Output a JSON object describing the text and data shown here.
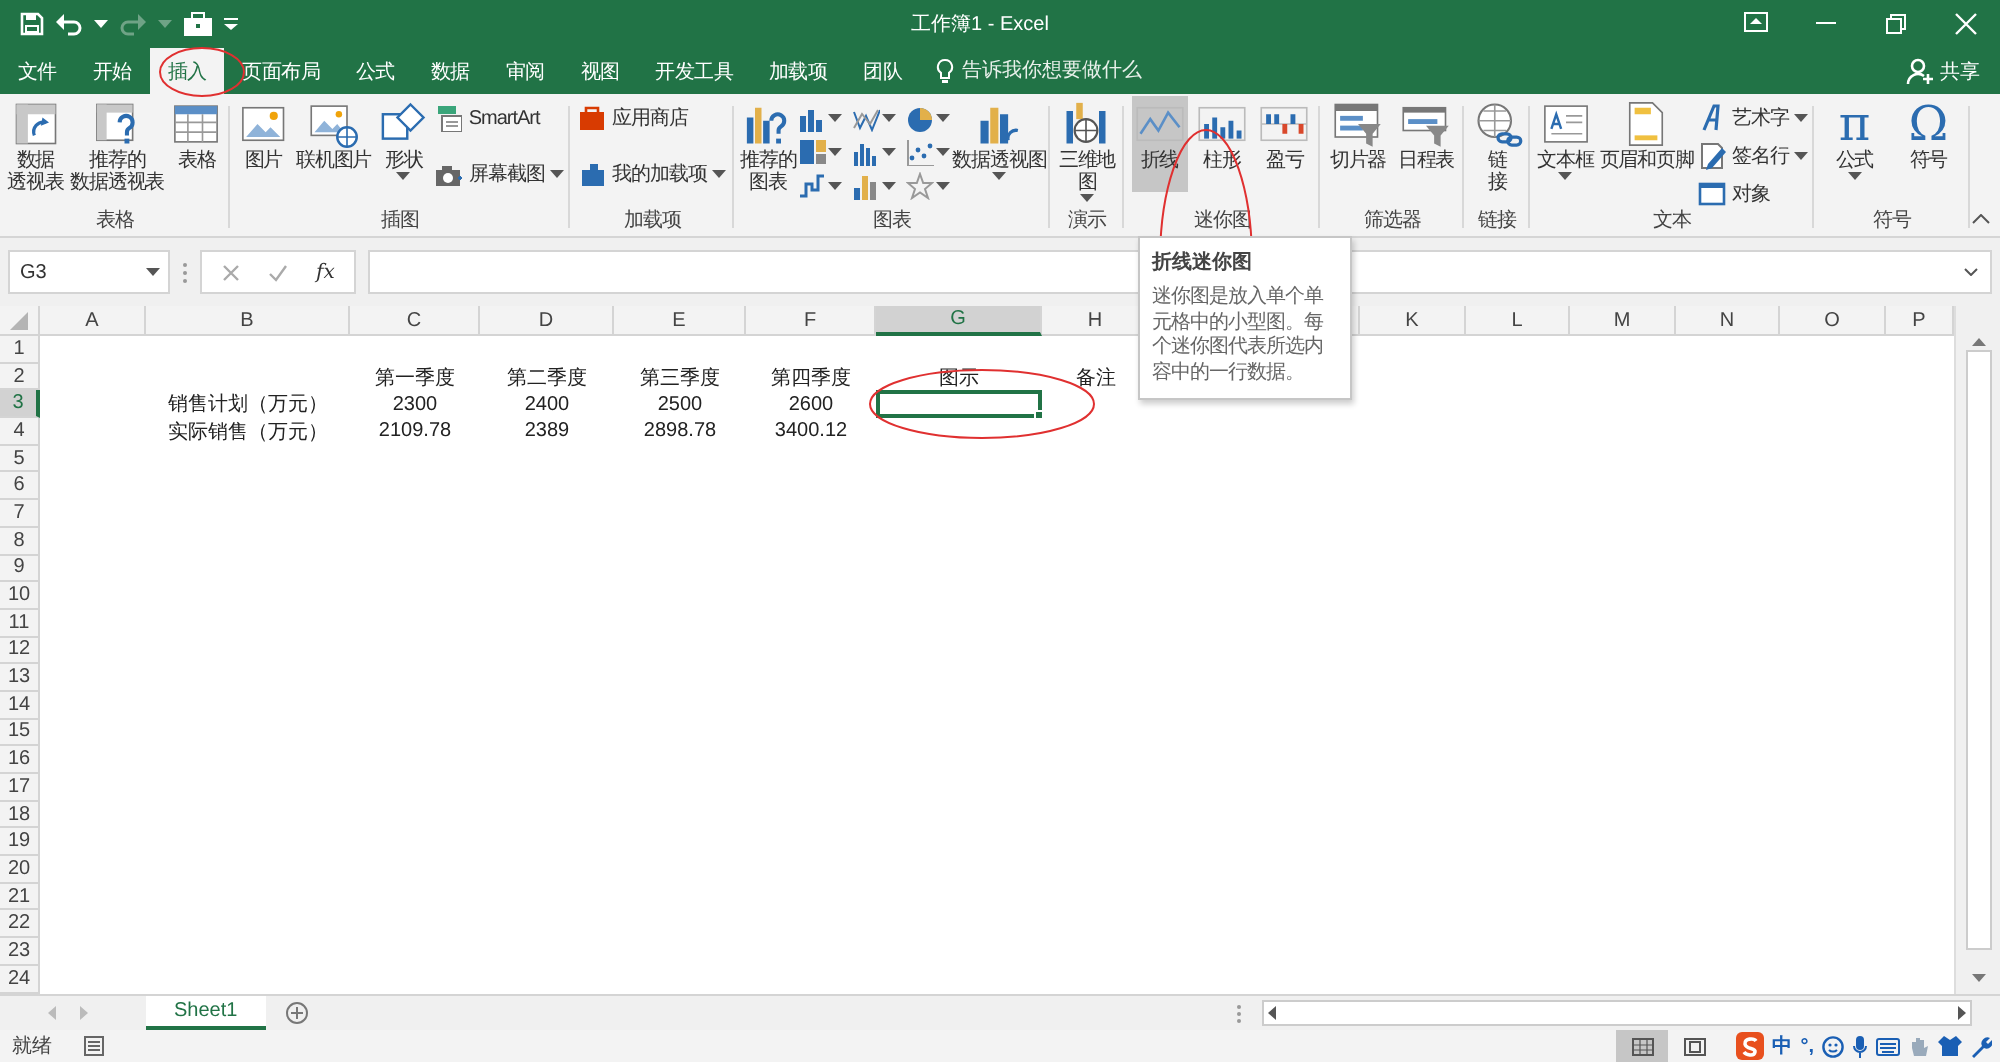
{
  "title_bar": {
    "title": "工作簿1 - Excel"
  },
  "tabs": [
    {
      "label": "文件",
      "selected": false
    },
    {
      "label": "开始",
      "selected": false
    },
    {
      "label": "插入",
      "selected": true
    },
    {
      "label": "页面布局",
      "selected": false
    },
    {
      "label": "公式",
      "selected": false
    },
    {
      "label": "数据",
      "selected": false
    },
    {
      "label": "审阅",
      "selected": false
    },
    {
      "label": "视图",
      "selected": false
    },
    {
      "label": "开发工具",
      "selected": false
    },
    {
      "label": "加载项",
      "selected": false
    },
    {
      "label": "团队",
      "selected": false
    }
  ],
  "tell_me": {
    "placeholder": "告诉我你想要做什么"
  },
  "share": {
    "label": "共享"
  },
  "ribbon_groups": [
    {
      "label": "表格",
      "items": [
        {
          "kind": "large",
          "label": "数据透视表",
          "dropdown": false,
          "highlighted": false
        },
        {
          "kind": "large",
          "label": "推荐的数据透视表",
          "dropdown": false,
          "highlighted": false
        },
        {
          "kind": "large",
          "label": "表格",
          "dropdown": false,
          "highlighted": false
        }
      ]
    },
    {
      "label": "插图",
      "items": [
        {
          "kind": "large",
          "label": "图片",
          "dropdown": false,
          "highlighted": false
        },
        {
          "kind": "large",
          "label": "联机图片",
          "dropdown": false,
          "highlighted": false
        },
        {
          "kind": "large",
          "label": "形状",
          "dropdown": true,
          "highlighted": false
        },
        {
          "kind": "small",
          "label": "SmartArt",
          "dropdown": false,
          "highlighted": false
        },
        {
          "kind": "small",
          "label": "屏幕截图",
          "dropdown": true,
          "highlighted": false
        }
      ]
    },
    {
      "label": "加载项",
      "items": [
        {
          "kind": "small",
          "label": "应用商店",
          "dropdown": false,
          "highlighted": false
        },
        {
          "kind": "small",
          "label": "我的加载项",
          "dropdown": true,
          "highlighted": false
        }
      ]
    },
    {
      "label": "图表",
      "items": [
        {
          "kind": "large",
          "label": "推荐的图表",
          "dropdown": false,
          "highlighted": false
        },
        {
          "kind": "chart",
          "dropdown": true,
          "highlighted": false
        },
        {
          "kind": "chart",
          "dropdown": true,
          "highlighted": false
        },
        {
          "kind": "chart",
          "dropdown": true,
          "highlighted": false
        },
        {
          "kind": "chart",
          "dropdown": true,
          "highlighted": false
        },
        {
          "kind": "chart",
          "dropdown": true,
          "highlighted": false
        },
        {
          "kind": "chart",
          "dropdown": true,
          "highlighted": false
        },
        {
          "kind": "chart",
          "dropdown": true,
          "highlighted": false
        },
        {
          "kind": "chart",
          "dropdown": true,
          "highlighted": false
        },
        {
          "kind": "chart",
          "dropdown": true,
          "highlighted": false
        },
        {
          "kind": "large",
          "label": "数据透视图",
          "dropdown": true,
          "highlighted": false
        }
      ]
    },
    {
      "label": "演示",
      "items": [
        {
          "kind": "large",
          "label": "三维地图",
          "dropdown": true,
          "highlighted": false
        }
      ]
    },
    {
      "label": "迷你图",
      "items": [
        {
          "kind": "large",
          "label": "折线",
          "dropdown": false,
          "highlighted": true
        },
        {
          "kind": "large",
          "label": "柱形",
          "dropdown": false,
          "highlighted": false
        },
        {
          "kind": "large",
          "label": "盈亏",
          "dropdown": false,
          "highlighted": false
        }
      ]
    },
    {
      "label": "筛选器",
      "items": [
        {
          "kind": "large",
          "label": "切片器",
          "dropdown": false,
          "highlighted": false
        },
        {
          "kind": "large",
          "label": "日程表",
          "dropdown": false,
          "highlighted": false
        }
      ]
    },
    {
      "label": "链接",
      "items": [
        {
          "kind": "large",
          "label": "链接",
          "dropdown": false,
          "highlighted": false
        }
      ]
    },
    {
      "label": "文本",
      "items": [
        {
          "kind": "large",
          "label": "文本框",
          "dropdown": true,
          "highlighted": false
        },
        {
          "kind": "large",
          "label": "页眉和页脚",
          "dropdown": false,
          "highlighted": false
        },
        {
          "kind": "small",
          "label": "艺术字",
          "dropdown": true,
          "highlighted": false
        },
        {
          "kind": "small",
          "label": "签名行",
          "dropdown": true,
          "highlighted": false
        },
        {
          "kind": "small",
          "label": "对象",
          "dropdown": false,
          "highlighted": false
        }
      ]
    },
    {
      "label": "符号",
      "items": [
        {
          "kind": "glyph",
          "glyph": "π",
          "label": "公式",
          "dropdown": true,
          "highlighted": false
        },
        {
          "kind": "glyph",
          "glyph": "Ω",
          "label": "符号",
          "dropdown": false,
          "highlighted": false
        }
      ]
    }
  ],
  "formula_bar": {
    "name_box": "G3",
    "function_label": "fx"
  },
  "tooltip": {
    "title": "折线迷你图",
    "text": "迷你图是放入单个单元格中的小型图。每个迷你图代表所选内容中的一行数据。"
  },
  "grid": {
    "columns": [
      {
        "label": "A",
        "selected": false
      },
      {
        "label": "B",
        "selected": false
      },
      {
        "label": "C",
        "selected": false
      },
      {
        "label": "D",
        "selected": false
      },
      {
        "label": "E",
        "selected": false
      },
      {
        "label": "F",
        "selected": false
      },
      {
        "label": "G",
        "selected": true
      },
      {
        "label": "H",
        "selected": false
      },
      {},
      {},
      {
        "label": "K",
        "selected": false
      },
      {
        "label": "L",
        "selected": false
      },
      {
        "label": "M",
        "selected": false
      },
      {
        "label": "N",
        "selected": false
      },
      {
        "label": "O",
        "selected": false
      },
      {
        "label": "P",
        "selected": false
      }
    ],
    "rows": [
      {
        "label": "1",
        "selected": false
      },
      {
        "label": "2",
        "selected": false,
        "cells": [
          null,
          null,
          "第一季度",
          "第二季度",
          "第三季度",
          "第四季度",
          "图示",
          "备注"
        ]
      },
      {
        "label": "3",
        "selected": true,
        "cells": [
          null,
          "销售计划（万元）",
          "2300",
          "2400",
          "2500",
          "2600"
        ]
      },
      {
        "label": "4",
        "selected": false,
        "cells": [
          null,
          "实际销售（万元）",
          "2109.78",
          "2389",
          "2898.78",
          "3400.12"
        ]
      },
      {
        "label": "5",
        "selected": false
      },
      {
        "label": "6",
        "selected": false
      },
      {
        "label": "7",
        "selected": false
      },
      {
        "label": "8",
        "selected": false
      },
      {
        "label": "9",
        "selected": false
      },
      {
        "label": "10",
        "selected": false
      },
      {
        "label": "11",
        "selected": false
      },
      {
        "label": "12",
        "selected": false
      },
      {
        "label": "13",
        "selected": false
      },
      {
        "label": "14",
        "selected": false
      },
      {
        "label": "15",
        "selected": false
      },
      {
        "label": "16",
        "selected": false
      },
      {
        "label": "17",
        "selected": false
      },
      {
        "label": "18",
        "selected": false
      },
      {
        "label": "19",
        "selected": false
      },
      {
        "label": "20",
        "selected": false
      },
      {
        "label": "21",
        "selected": false
      },
      {
        "label": "22",
        "selected": false
      },
      {
        "label": "23",
        "selected": false
      },
      {
        "label": "24",
        "selected": false
      }
    ]
  },
  "sheets": [
    {
      "label": "Sheet1",
      "selected": true
    }
  ],
  "status_bar": {
    "text": "就绪",
    "views": [
      {
        "kind": "normal",
        "selected": true
      },
      {
        "kind": "page-layout",
        "selected": false
      }
    ],
    "ime": {
      "mode": "中",
      "punctuation": "°,"
    }
  }
}
